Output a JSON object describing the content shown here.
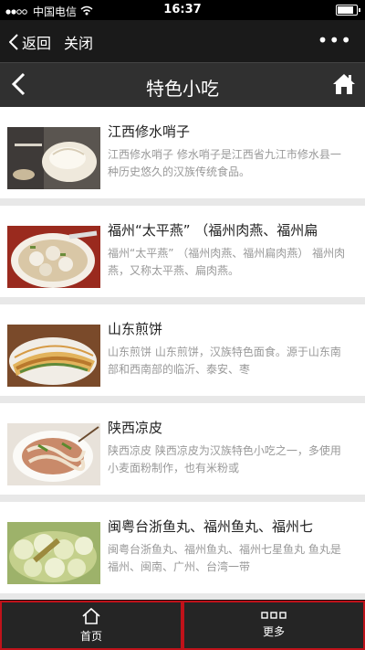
{
  "status": {
    "carrier": "中国电信",
    "time": "16:37",
    "battery_level": 0.92
  },
  "nav": {
    "back_label": "返回",
    "close_label": "关闭",
    "more_label": "•••"
  },
  "header": {
    "title": "特色小吃"
  },
  "items": [
    {
      "name": "江西修水哨子",
      "desc": "江西修水哨子 修水哨子是江西省九江市修水县一种历史悠久的汉族传统食品。",
      "image": "dumpling-photo"
    },
    {
      "name": "福州“太平燕” （福州肉燕、福州扁",
      "desc": "福州“太平燕” （福州肉燕、福州扁肉燕） 福州肉燕，又称太平燕、扁肉燕。",
      "image": "meatball-soup-photo"
    },
    {
      "name": "山东煎饼",
      "desc": "山东煎饼 山东煎饼，汉族特色面食。源于山东南部和西南部的临沂、泰安、枣",
      "image": "pancake-photo"
    },
    {
      "name": "陕西凉皮",
      "desc": "陕西凉皮 陕西凉皮为汉族特色小吃之一，多使用小麦面粉制作，也有米粉或",
      "image": "cold-noodle-photo"
    },
    {
      "name": "闽粤台浙鱼丸、福州鱼丸、福州七",
      "desc": "闽粤台浙鱼丸、福州鱼丸、福州七星鱼丸 鱼丸是福州、闽南、广州、台湾一带",
      "image": "fishball-photo"
    }
  ],
  "tabbar": {
    "home_label": "首页",
    "more_label": "更多"
  },
  "colors": {
    "tab_border": "#c0121a",
    "header_bg": "#303030"
  }
}
